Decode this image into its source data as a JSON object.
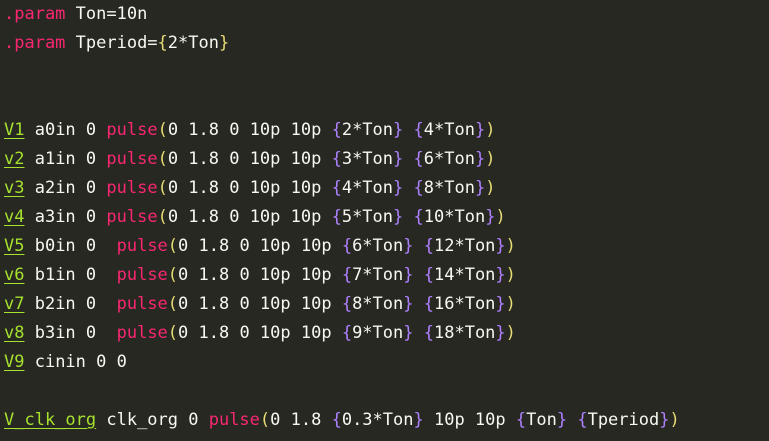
{
  "colors": {
    "background": "#272822",
    "text": "#F8F8F2",
    "directive": "#F92672",
    "source_name": "#A6E22E",
    "function": "#F92672",
    "paren": "#E6DB74",
    "brace": "#AE81FF"
  },
  "code_lines": [
    {
      "tokens": [
        [
          "directive",
          ".param"
        ],
        [
          "text",
          " Ton=10n"
        ]
      ]
    },
    {
      "tokens": [
        [
          "directive",
          ".param"
        ],
        [
          "text",
          " Tperiod="
        ],
        [
          "p",
          "{"
        ],
        [
          "text",
          "2*Ton"
        ],
        [
          "p",
          "}"
        ]
      ]
    },
    {
      "tokens": []
    },
    {
      "tokens": []
    },
    {
      "tokens": [
        [
          "src",
          "V1"
        ],
        [
          "text",
          " a0in 0 "
        ],
        [
          "func",
          "pulse"
        ],
        [
          "p",
          "("
        ],
        [
          "text",
          "0 1.8 0 10p 10p "
        ],
        [
          "b",
          "{"
        ],
        [
          "text",
          "2*Ton"
        ],
        [
          "b",
          "}"
        ],
        [
          "text",
          " "
        ],
        [
          "b",
          "{"
        ],
        [
          "text",
          "4*Ton"
        ],
        [
          "b",
          "}"
        ],
        [
          "p",
          ")"
        ]
      ]
    },
    {
      "tokens": [
        [
          "src",
          "v2"
        ],
        [
          "text",
          " a1in 0 "
        ],
        [
          "func",
          "pulse"
        ],
        [
          "p",
          "("
        ],
        [
          "text",
          "0 1.8 0 10p 10p "
        ],
        [
          "b",
          "{"
        ],
        [
          "text",
          "3*Ton"
        ],
        [
          "b",
          "}"
        ],
        [
          "text",
          " "
        ],
        [
          "b",
          "{"
        ],
        [
          "text",
          "6*Ton"
        ],
        [
          "b",
          "}"
        ],
        [
          "p",
          ")"
        ]
      ]
    },
    {
      "tokens": [
        [
          "src",
          "v3"
        ],
        [
          "text",
          " a2in 0 "
        ],
        [
          "func",
          "pulse"
        ],
        [
          "p",
          "("
        ],
        [
          "text",
          "0 1.8 0 10p 10p "
        ],
        [
          "b",
          "{"
        ],
        [
          "text",
          "4*Ton"
        ],
        [
          "b",
          "}"
        ],
        [
          "text",
          " "
        ],
        [
          "b",
          "{"
        ],
        [
          "text",
          "8*Ton"
        ],
        [
          "b",
          "}"
        ],
        [
          "p",
          ")"
        ]
      ]
    },
    {
      "tokens": [
        [
          "src",
          "v4"
        ],
        [
          "text",
          " a3in 0 "
        ],
        [
          "func",
          "pulse"
        ],
        [
          "p",
          "("
        ],
        [
          "text",
          "0 1.8 0 10p 10p "
        ],
        [
          "b",
          "{"
        ],
        [
          "text",
          "5*Ton"
        ],
        [
          "b",
          "}"
        ],
        [
          "text",
          " "
        ],
        [
          "b",
          "{"
        ],
        [
          "text",
          "10*Ton"
        ],
        [
          "b",
          "}"
        ],
        [
          "p",
          ")"
        ]
      ]
    },
    {
      "tokens": [
        [
          "src",
          "V5"
        ],
        [
          "text",
          " b0in 0  "
        ],
        [
          "func",
          "pulse"
        ],
        [
          "p",
          "("
        ],
        [
          "text",
          "0 1.8 0 10p 10p "
        ],
        [
          "b",
          "{"
        ],
        [
          "text",
          "6*Ton"
        ],
        [
          "b",
          "}"
        ],
        [
          "text",
          " "
        ],
        [
          "b",
          "{"
        ],
        [
          "text",
          "12*Ton"
        ],
        [
          "b",
          "}"
        ],
        [
          "p",
          ")"
        ]
      ]
    },
    {
      "tokens": [
        [
          "src",
          "v6"
        ],
        [
          "text",
          " b1in 0  "
        ],
        [
          "func",
          "pulse"
        ],
        [
          "p",
          "("
        ],
        [
          "text",
          "0 1.8 0 10p 10p "
        ],
        [
          "b",
          "{"
        ],
        [
          "text",
          "7*Ton"
        ],
        [
          "b",
          "}"
        ],
        [
          "text",
          " "
        ],
        [
          "b",
          "{"
        ],
        [
          "text",
          "14*Ton"
        ],
        [
          "b",
          "}"
        ],
        [
          "p",
          ")"
        ]
      ]
    },
    {
      "tokens": [
        [
          "src",
          "v7"
        ],
        [
          "text",
          " b2in 0  "
        ],
        [
          "func",
          "pulse"
        ],
        [
          "p",
          "("
        ],
        [
          "text",
          "0 1.8 0 10p 10p "
        ],
        [
          "b",
          "{"
        ],
        [
          "text",
          "8*Ton"
        ],
        [
          "b",
          "}"
        ],
        [
          "text",
          " "
        ],
        [
          "b",
          "{"
        ],
        [
          "text",
          "16*Ton"
        ],
        [
          "b",
          "}"
        ],
        [
          "p",
          ")"
        ]
      ]
    },
    {
      "tokens": [
        [
          "src",
          "v8"
        ],
        [
          "text",
          " b3in 0  "
        ],
        [
          "func",
          "pulse"
        ],
        [
          "p",
          "("
        ],
        [
          "text",
          "0 1.8 0 10p 10p "
        ],
        [
          "b",
          "{"
        ],
        [
          "text",
          "9*Ton"
        ],
        [
          "b",
          "}"
        ],
        [
          "text",
          " "
        ],
        [
          "b",
          "{"
        ],
        [
          "text",
          "18*Ton"
        ],
        [
          "b",
          "}"
        ],
        [
          "p",
          ")"
        ]
      ]
    },
    {
      "tokens": [
        [
          "src",
          "V9"
        ],
        [
          "text",
          " cinin 0 0"
        ]
      ]
    },
    {
      "tokens": []
    },
    {
      "tokens": [
        [
          "src",
          "V_clk_org"
        ],
        [
          "text",
          " clk_org 0 "
        ],
        [
          "func",
          "pulse"
        ],
        [
          "p",
          "("
        ],
        [
          "text",
          "0 1.8 "
        ],
        [
          "b",
          "{"
        ],
        [
          "text",
          "0.3*Ton"
        ],
        [
          "b",
          "}"
        ],
        [
          "text",
          " 10p 10p "
        ],
        [
          "b",
          "{"
        ],
        [
          "text",
          "Ton"
        ],
        [
          "b",
          "}"
        ],
        [
          "text",
          " "
        ],
        [
          "b",
          "{"
        ],
        [
          "text",
          "Tperiod"
        ],
        [
          "b",
          "}"
        ],
        [
          "p",
          ")"
        ]
      ]
    }
  ]
}
